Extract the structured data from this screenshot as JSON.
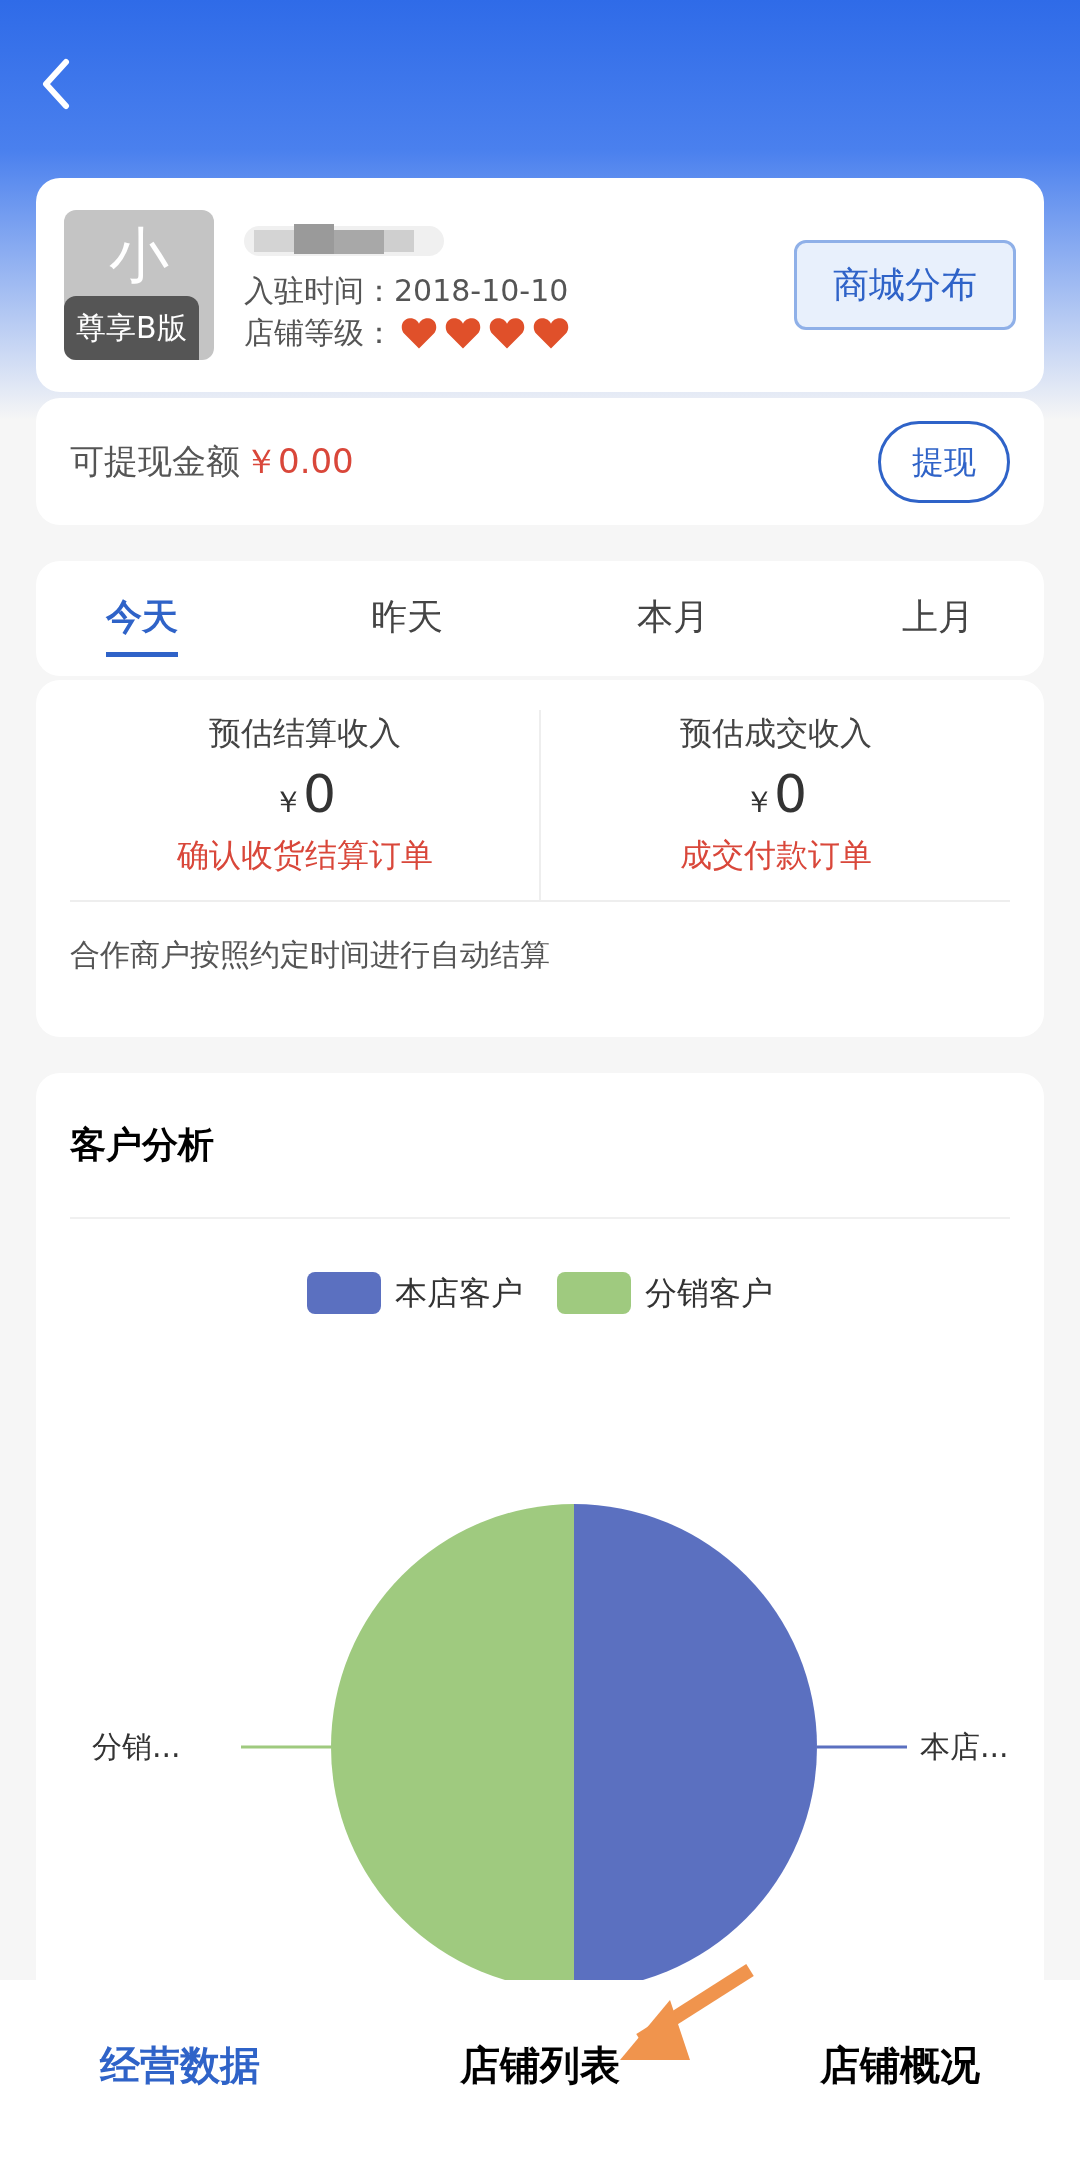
{
  "profile": {
    "avatar_text": "小",
    "badge": "尊享B版",
    "joined": "入驻时间：2018-10-10",
    "level_label": "店铺等级：",
    "stars": 4,
    "button": "商城分布"
  },
  "balance": {
    "label": "可提现金额",
    "amount": "￥0.00",
    "button": "提现"
  },
  "tabs": [
    {
      "label": "今天",
      "selected": true
    },
    {
      "label": "昨天",
      "selected": false
    },
    {
      "label": "本月",
      "selected": false
    },
    {
      "label": "上月",
      "selected": false
    }
  ],
  "stats": [
    {
      "title": "预估结算收入",
      "currency": "￥",
      "value": "0",
      "link": "确认收货结算订单"
    },
    {
      "title": "预估成交收入",
      "currency": "￥",
      "value": "0",
      "link": "成交付款订单"
    }
  ],
  "stats_note": "合作商户按照约定时间进行自动结算",
  "customer_analysis": {
    "chart_data": {
      "type": "pie",
      "title": "客户分析",
      "categories": [
        "本店客户",
        "分销客户"
      ],
      "series": [
        {
          "values": [
            50,
            50
          ]
        }
      ],
      "colors": [
        "#5b70c0",
        "#9fca7f"
      ],
      "legend": "top"
    },
    "slice_labels": [
      "分销...",
      "本店..."
    ]
  },
  "bottom_nav": [
    {
      "label": "经营数据",
      "selected": true
    },
    {
      "label": "店铺列表",
      "selected": false
    },
    {
      "label": "店铺概况",
      "selected": false
    }
  ]
}
